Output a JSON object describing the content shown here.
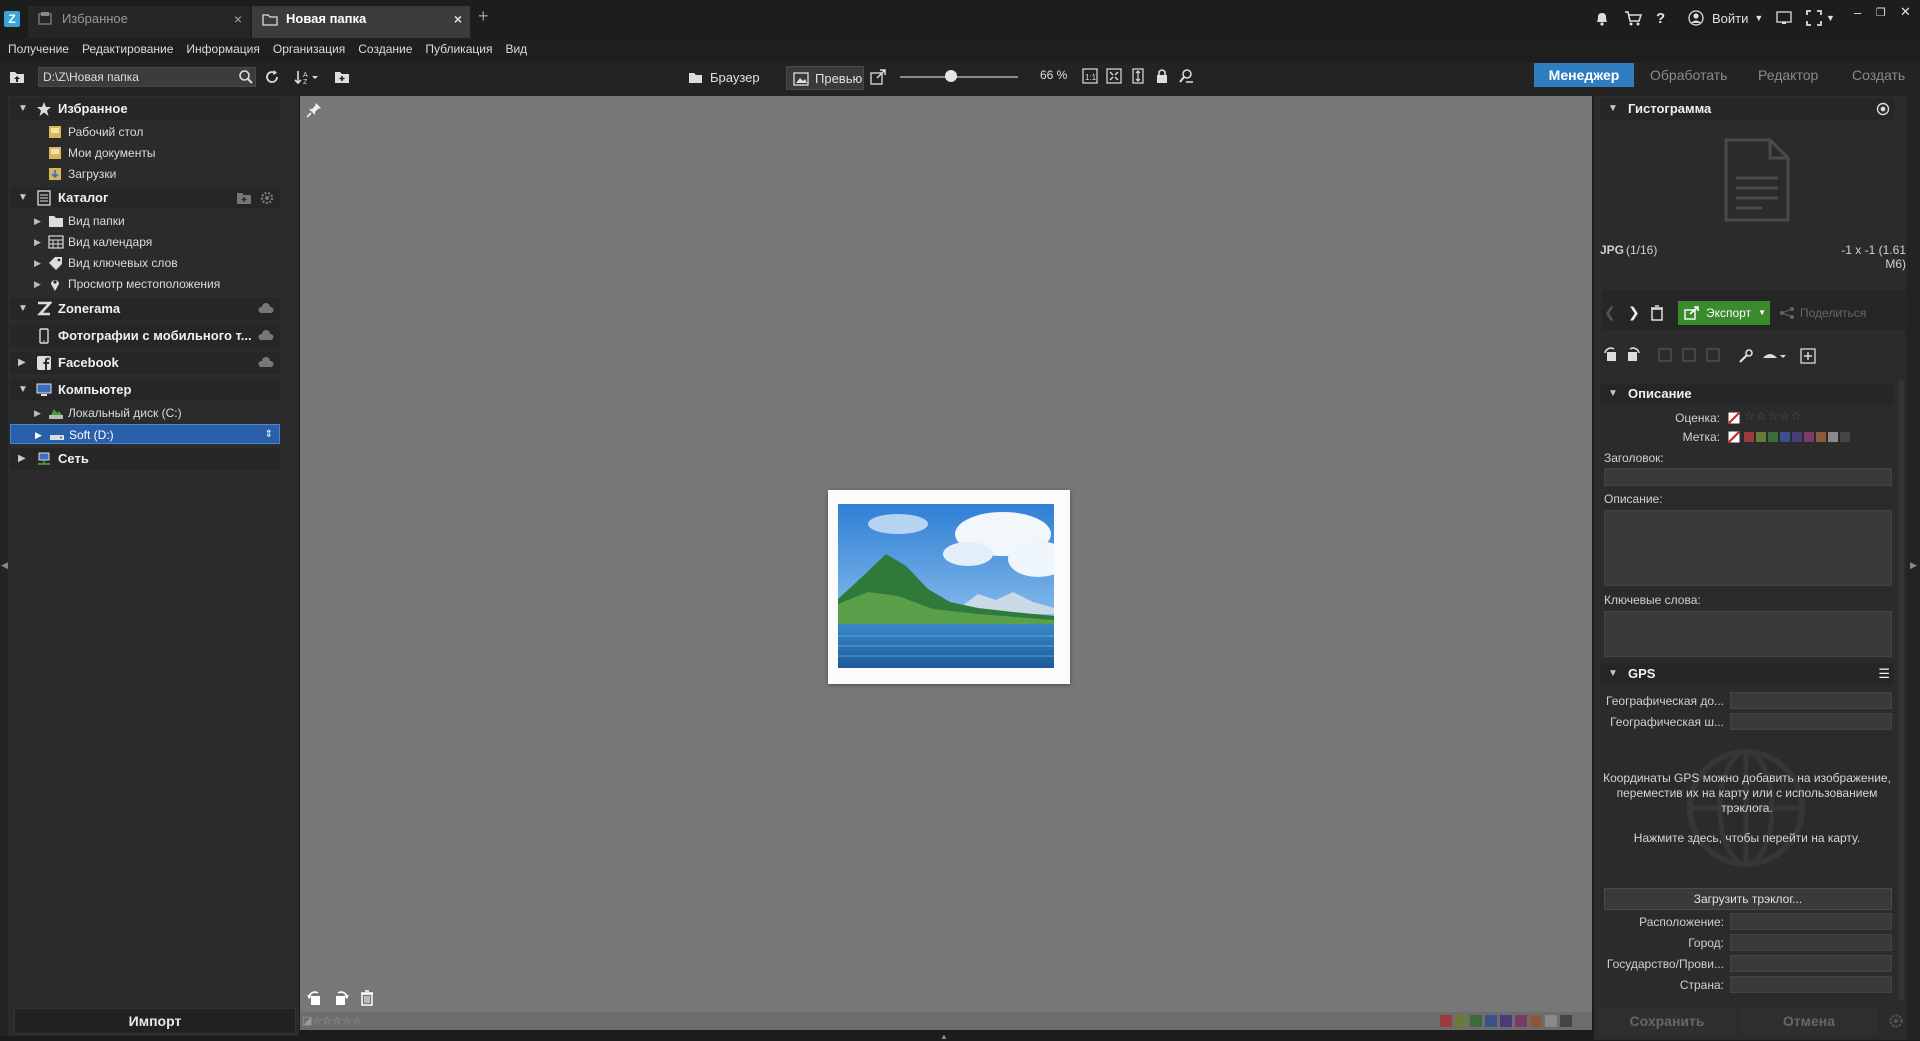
{
  "tabs": [
    {
      "label": "Избранное",
      "active": false
    },
    {
      "label": "Новая папка",
      "active": true
    }
  ],
  "topbar": {
    "login_label": "Войти"
  },
  "menu": [
    "Получение",
    "Редактирование",
    "Информация",
    "Организация",
    "Создание",
    "Публикация",
    "Вид"
  ],
  "toolbar": {
    "path_value": "D:\\Z\\Новая папка",
    "browser_label": "Браузер",
    "preview_label": "Превью",
    "zoom_value": "66 %",
    "modes": [
      "Менеджер",
      "Обработать",
      "Редактор",
      "Создать"
    ]
  },
  "left": {
    "favorites": {
      "title": "Избранное",
      "items": [
        "Рабочий стол",
        "Мои документы",
        "Загрузки"
      ]
    },
    "catalog": {
      "title": "Каталог",
      "items": [
        "Вид папки",
        "Вид календаря",
        "Вид ключевых слов",
        "Просмотр местоположения"
      ]
    },
    "zonerama": "Zonerama",
    "mobile": "Фотографии с мобильного т...",
    "facebook": "Facebook",
    "computer": {
      "title": "Компьютер",
      "items": [
        "Локальный диск (C:)",
        "Soft (D:)"
      ]
    },
    "network": "Сеть",
    "import_label": "Импорт"
  },
  "right": {
    "histogram_title": "Гистограмма",
    "file_format": "JPG",
    "file_index": "(1/16)",
    "file_dims": "-1 x -1 (1.61 M6)",
    "export_label": "Экспорт",
    "share_label": "Поделиться",
    "description_title": "Описание",
    "rating_label": "Оценка:",
    "label_label": "Метка:",
    "heading_label": "Заголовок:",
    "desc_label": "Описание:",
    "keywords_label": "Ключевые слова:",
    "gps_title": "GPS",
    "gps_lon_label": "Географическая до...",
    "gps_lat_label": "Географическая ш...",
    "gps_info": "Координаты GPS можно добавить на изображение, переместив их на карту или с использованием трэклога.",
    "gps_map_link": "Нажмите здесь, чтобы перейти на карту.",
    "load_track_label": "Загрузить трэклог...",
    "location_label": "Расположение:",
    "city_label": "Город:",
    "state_label": "Государство/Прови...",
    "country_label": "Страна:",
    "save_label": "Сохранить",
    "cancel_label": "Отмена"
  },
  "colors": {
    "accent": "#2e7dc0",
    "export": "#3b8a2e",
    "selection": "#2a5faa"
  },
  "label_swatches": [
    "#9b3b3b",
    "#6a7a3b",
    "#3b6a3b",
    "#3b4f8a",
    "#4a3b7a",
    "#7a3b6a",
    "#8a5a3b",
    "#8a8a8a",
    "#444444"
  ]
}
